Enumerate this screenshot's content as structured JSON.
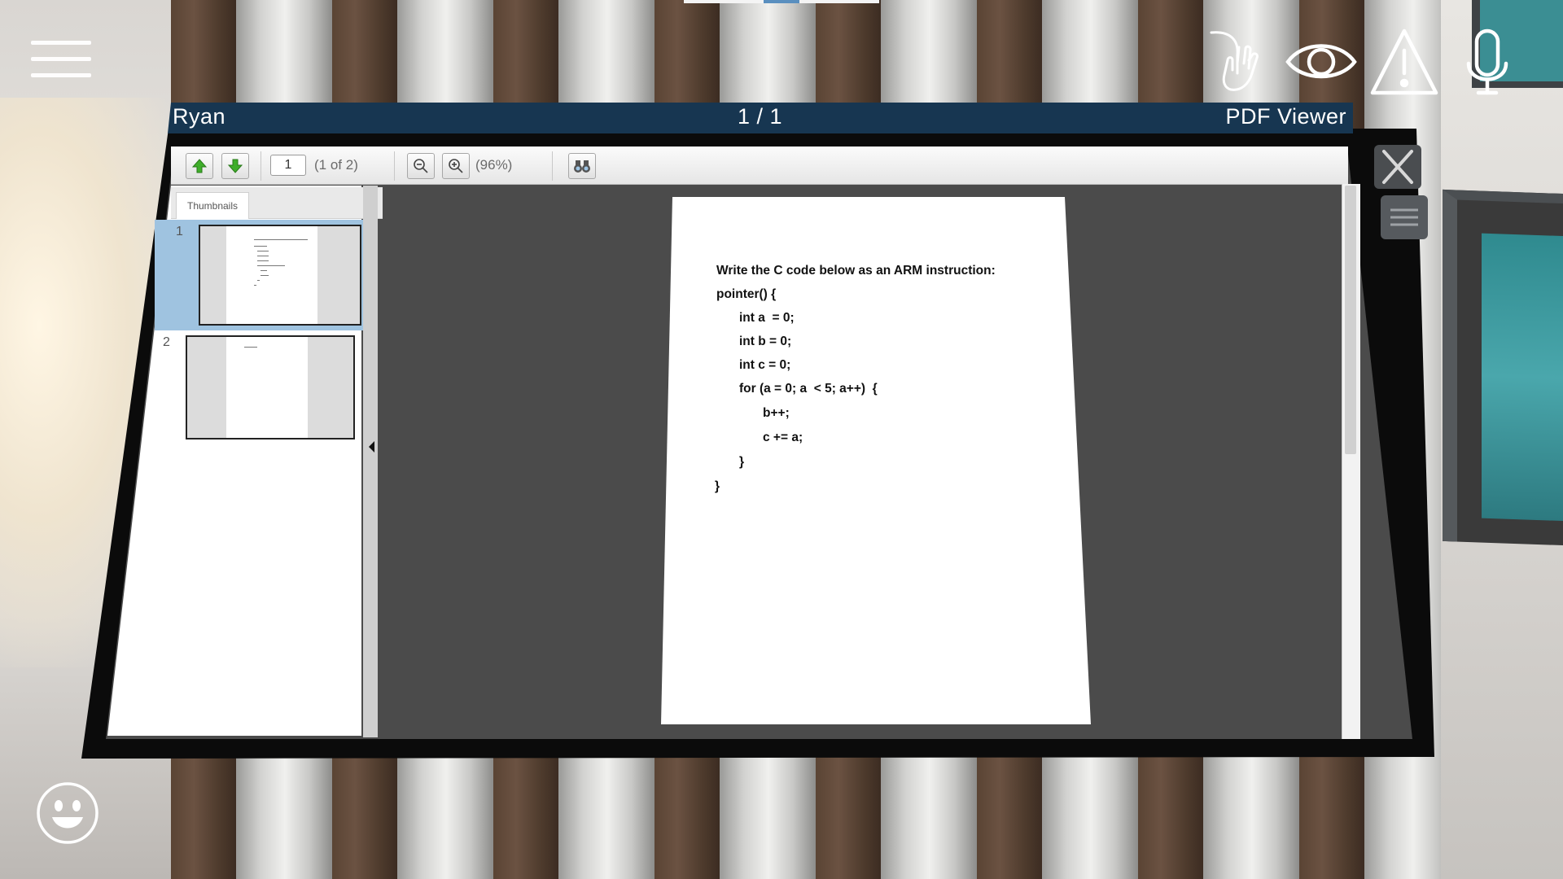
{
  "window": {
    "user": "Ryan",
    "page_indicator": "1 / 1",
    "app_title": "PDF Viewer"
  },
  "toolbar": {
    "page_number": "1",
    "page_count": "(1 of 2)",
    "zoom": "(96%)"
  },
  "sidebar": {
    "tab_label": "Thumbnails",
    "thumbnails": [
      {
        "number": "1",
        "selected": true
      },
      {
        "number": "2",
        "selected": false
      }
    ]
  },
  "document": {
    "lines": [
      "Write the C code below as an ARM instruction:",
      "pointer() {",
      "int a  = 0;",
      "int b = 0;",
      "int c = 0;",
      "for (a = 0; a  < 5; a++)  {",
      "b++;",
      "c += a;",
      "}",
      "}"
    ]
  },
  "icons": {
    "menu": "hamburger-icon",
    "hand": "raise-hand-icon",
    "eye": "eye-icon",
    "warning": "warning-icon",
    "mic": "microphone-icon",
    "emoji": "smiley-icon",
    "close": "close-icon",
    "prev": "arrow-up-icon",
    "next": "arrow-down-icon",
    "zoom_out": "zoom-out-icon",
    "zoom_in": "zoom-in-icon",
    "find": "binoculars-icon"
  }
}
